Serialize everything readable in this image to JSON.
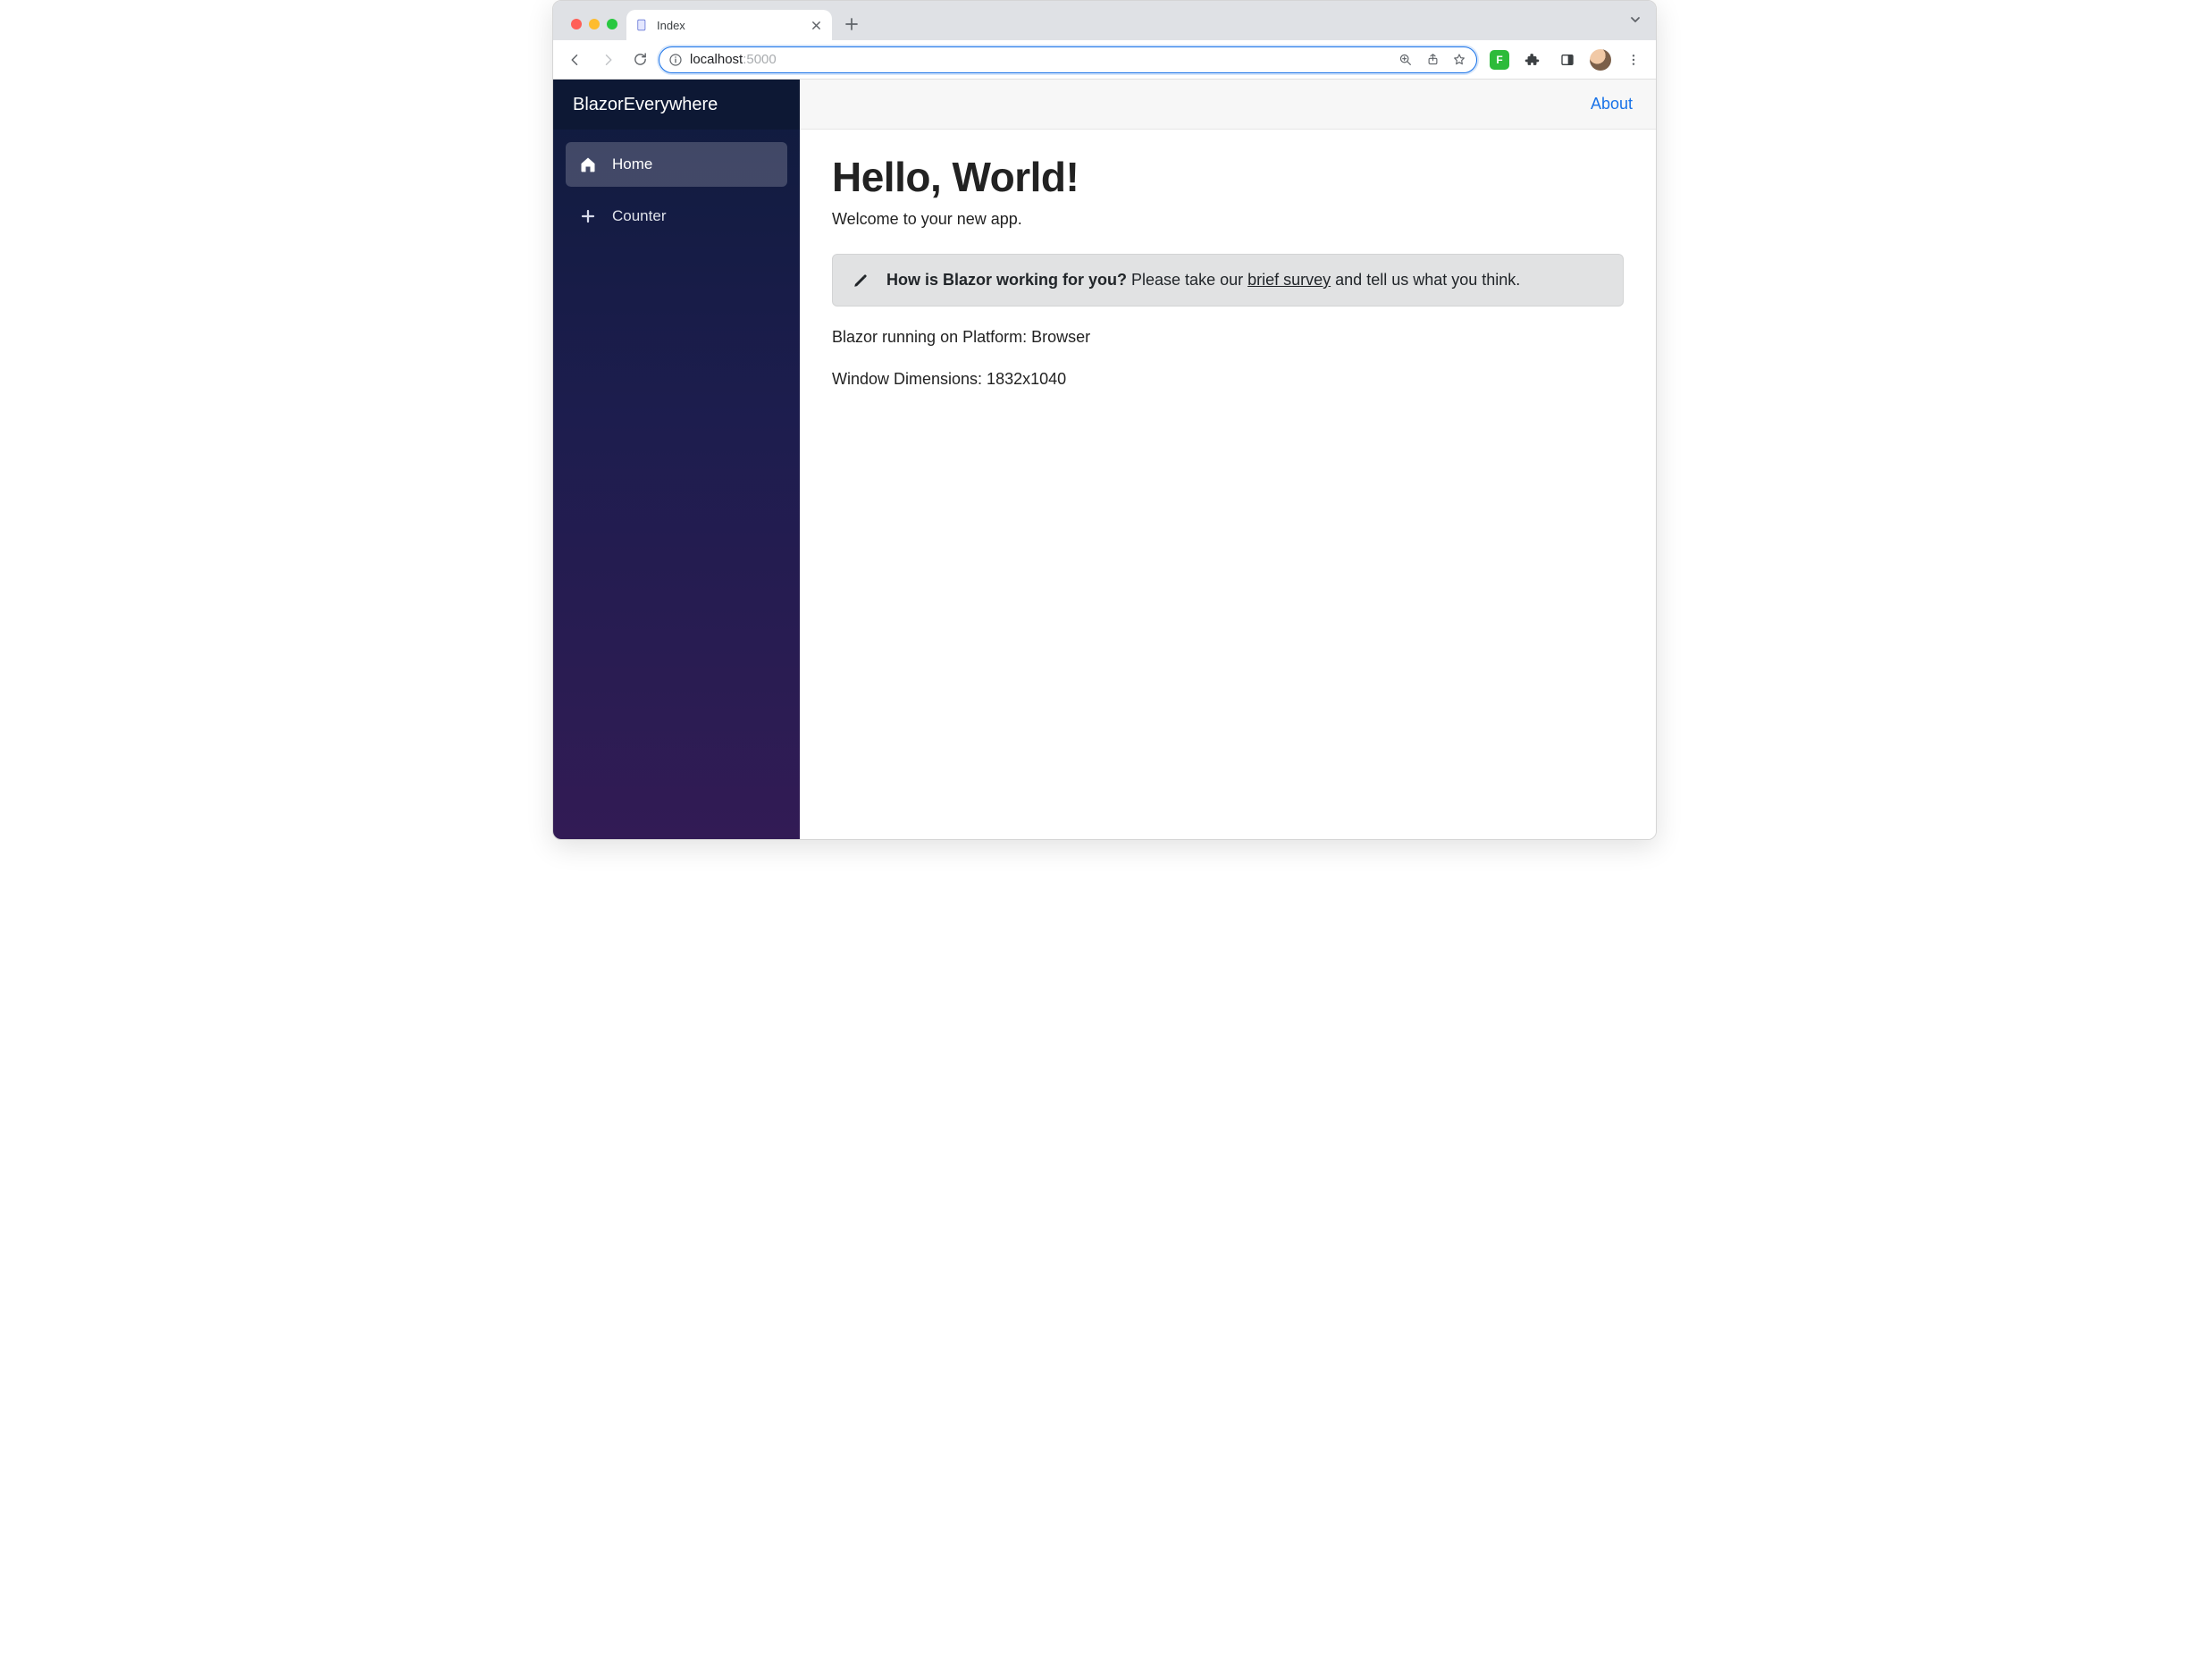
{
  "browser": {
    "tab_title": "Index",
    "url_domain": "localhost",
    "url_port": ":5000",
    "extension_badge": "F"
  },
  "sidebar": {
    "brand": "BlazorEverywhere",
    "items": [
      {
        "label": "Home"
      },
      {
        "label": "Counter"
      }
    ]
  },
  "topbar": {
    "about": "About"
  },
  "page": {
    "heading": "Hello, World!",
    "welcome": "Welcome to your new app.",
    "survey_strong": "How is Blazor working for you?",
    "survey_before": " Please take our ",
    "survey_link": "brief survey",
    "survey_after": " and tell us what you think.",
    "platform_line": "Blazor running on Platform: Browser",
    "dimensions_line": "Window Dimensions: 1832x1040"
  }
}
